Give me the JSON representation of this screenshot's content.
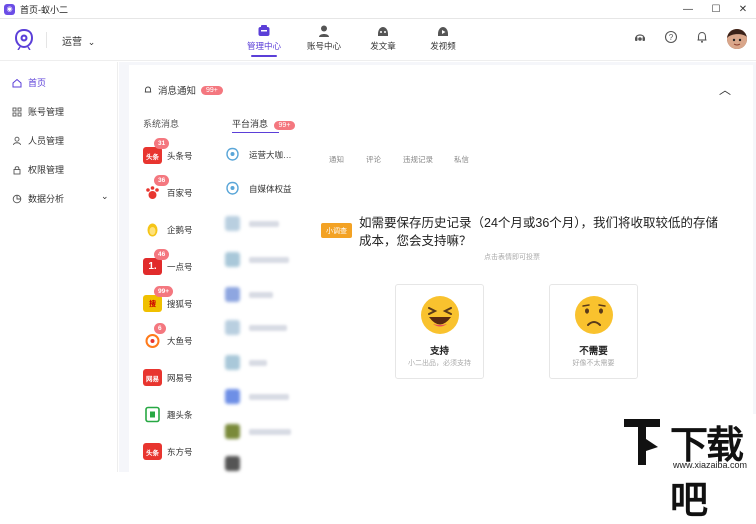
{
  "window": {
    "title": "首页-蚁小二",
    "minimize": "—",
    "maximize": "☐",
    "close": "✕"
  },
  "topnav": {
    "ops_label": "运营",
    "ops_chevron": "⌄",
    "items": [
      {
        "label": "管理中心",
        "icon": "management-icon",
        "active": true
      },
      {
        "label": "账号中心",
        "icon": "account-icon",
        "active": false
      },
      {
        "label": "发文章",
        "icon": "article-icon",
        "active": false
      },
      {
        "label": "发视频",
        "icon": "video-icon",
        "active": false
      }
    ],
    "right_icons": [
      "service-icon",
      "help-icon",
      "bell-icon"
    ]
  },
  "sidebar": {
    "items": [
      {
        "label": "首页",
        "icon": "home-icon",
        "active": true
      },
      {
        "label": "账号管理",
        "icon": "grid-icon",
        "active": false
      },
      {
        "label": "人员管理",
        "icon": "user-icon",
        "active": false
      },
      {
        "label": "权限管理",
        "icon": "lock-icon",
        "active": false
      },
      {
        "label": "数据分析",
        "icon": "analytics-icon",
        "active": false,
        "chevron": "⌄"
      }
    ]
  },
  "notice": {
    "title": "消息通知",
    "badge": "99+",
    "collapse": "︿",
    "tabs": [
      {
        "label": "系统消息",
        "badge": ""
      },
      {
        "label": "平台消息",
        "badge": "99+"
      }
    ],
    "subtabs": [
      "通知",
      "评论",
      "违规记录",
      "私信"
    ]
  },
  "platforms": [
    {
      "name": "头条号",
      "glyph": "头条",
      "color": "#e8352f",
      "badge": "31"
    },
    {
      "name": "百家号",
      "glyph": "百",
      "color": "#e8352f",
      "badge": "36"
    },
    {
      "name": "企鹅号",
      "glyph": "",
      "color": "#f5c518",
      "badge": ""
    },
    {
      "name": "一点号",
      "glyph": "1.",
      "color": "#e12b2b",
      "badge": "46"
    },
    {
      "name": "搜狐号",
      "glyph": "搜",
      "color": "#f0c000",
      "badge": "99+"
    },
    {
      "name": "大鱼号",
      "glyph": "",
      "color": "#ff7a1a",
      "badge": "6"
    },
    {
      "name": "网易号",
      "glyph": "网易",
      "color": "#e8352f",
      "badge": ""
    },
    {
      "name": "趣头条",
      "glyph": "",
      "color": "#27a843",
      "badge": ""
    },
    {
      "name": "东方号",
      "glyph": "头条",
      "color": "#e8352f",
      "badge": ""
    }
  ],
  "messages": [
    {
      "title": "运营大咖…",
      "icon_color": "#5aa6d8"
    },
    {
      "title": "自媒体权益",
      "icon_color": "#5aa6d8"
    }
  ],
  "survey": {
    "tag": "小调查",
    "question": "如需要保存历史记录（24个月或36个月），我们将收取较低的存储成本，您会支持嘛？",
    "hint": "点击表情即可投票",
    "options": [
      {
        "label": "支持",
        "sub": "小二出品，必须支持",
        "face": "laughing-face-icon"
      },
      {
        "label": "不需要",
        "sub": "好像不太需要",
        "face": "sad-face-icon"
      }
    ]
  },
  "watermark": {
    "text": "下载吧",
    "url": "www.xiazaiba.com"
  },
  "colors": {
    "accent": "#5b3fd8",
    "badge": "#f4777f",
    "survey_tag": "#f3a224",
    "content_bg": "#f5f6fa"
  }
}
